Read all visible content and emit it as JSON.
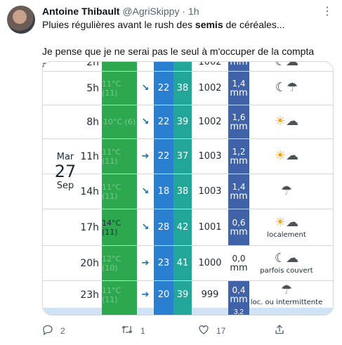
{
  "tweet": {
    "author_name": "Antoine Thibault",
    "handle": "@AgriSkippy",
    "separator": "·",
    "time": "1h",
    "text_line1_pre": "Pluies régulières avant le rush des ",
    "text_line1_bold": "semis",
    "text_line1_post": " de céréales...",
    "text_line2": "Je pense que je ne serai pas le seul à m'occuper de la compta aujourd'hui.",
    "more_icon": "more-icon"
  },
  "forecast": {
    "date": {
      "dow": "Mar",
      "day": "27",
      "month": "Sep"
    },
    "rows": [
      {
        "hour": "2h",
        "temp": "",
        "arrow": "",
        "wind": "",
        "gust": "",
        "pressure": "1002",
        "rain_val": "",
        "rain_unit": "mm",
        "rain_style": "blue",
        "icon": "night-cloud",
        "condition": ""
      },
      {
        "hour": "5h",
        "temp": "11°C (11)",
        "arrow": "↘",
        "wind": "22",
        "gust": "38",
        "pressure": "1002",
        "rain_val": "1,4",
        "rain_unit": "mm",
        "rain_style": "blue",
        "icon": "night-rain",
        "condition": ""
      },
      {
        "hour": "8h",
        "temp": "10°C (6)",
        "arrow": "↘",
        "wind": "22",
        "gust": "39",
        "pressure": "1002",
        "rain_val": "1,6",
        "rain_unit": "mm",
        "rain_style": "blue",
        "icon": "sun-cloud-rain",
        "condition": ""
      },
      {
        "hour": "11h",
        "temp": "11°C (11)",
        "arrow": "➔",
        "wind": "22",
        "gust": "37",
        "pressure": "1003",
        "rain_val": "1,2",
        "rain_unit": "mm",
        "rain_style": "blue",
        "icon": "sun-cloud-rain",
        "condition": ""
      },
      {
        "hour": "14h",
        "temp": "11°C (11)",
        "arrow": "↘",
        "wind": "18",
        "gust": "38",
        "pressure": "1003",
        "rain_val": "1,4",
        "rain_unit": "mm",
        "rain_style": "blue",
        "icon": "cloud-rain",
        "condition": ""
      },
      {
        "hour": "17h",
        "temp": "14°C (11)",
        "arrow": "↘",
        "wind": "28",
        "gust": "42",
        "pressure": "1001",
        "rain_val": "0,6",
        "rain_unit": "mm",
        "rain_style": "blue",
        "icon": "sun-cloud-rain",
        "condition": "localement"
      },
      {
        "hour": "20h",
        "temp": "12°C (10)",
        "arrow": "➔",
        "wind": "23",
        "gust": "41",
        "pressure": "1000",
        "rain_val": "0,0",
        "rain_unit": "mm",
        "rain_style": "white",
        "icon": "night-cloud",
        "condition": "parfois couvert"
      },
      {
        "hour": "23h",
        "temp": "11°C (11)",
        "arrow": "➔",
        "wind": "20",
        "gust": "39",
        "pressure": "999",
        "rain_val": "0,4",
        "rain_unit": "mm",
        "rain_style": "blue",
        "icon": "cloud-rain",
        "condition": "loc. ou intermittente"
      }
    ],
    "next_rain_val": "3,2"
  },
  "actions": {
    "reply_count": "2",
    "retweet_count": "1",
    "like_count": "17"
  }
}
